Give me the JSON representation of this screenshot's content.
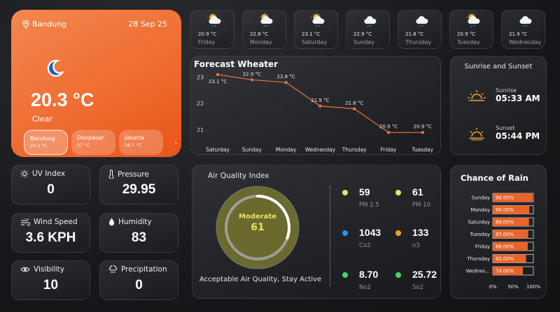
{
  "main": {
    "location": "Bandung",
    "date": "28 Sep 25",
    "temperature": "20.3 °C",
    "condition": "Clear",
    "icon": "moon-icon",
    "next_icon": "chevron-right-icon",
    "cities": [
      {
        "name": "Bandung",
        "temp": "20.3 °C"
      },
      {
        "name": "Denpasar",
        "temp": "27 °C"
      },
      {
        "name": "Jakarta",
        "temp": "26.1 °C"
      }
    ]
  },
  "forecast": [
    {
      "day": "Friday",
      "temp": "20.9 °C",
      "icon": "sun-cloud-rain-icon"
    },
    {
      "day": "Monday",
      "temp": "22.8 °C",
      "icon": "sun-cloud-rain-icon"
    },
    {
      "day": "Saturday",
      "temp": "23.1 °C",
      "icon": "sun-cloud-rain-icon"
    },
    {
      "day": "Sunday",
      "temp": "22.9 °C",
      "icon": "cloud-rain-icon"
    },
    {
      "day": "Thursday",
      "temp": "21.8 °C",
      "icon": "cloud-rain-icon"
    },
    {
      "day": "Tuesday",
      "temp": "20.9 °C",
      "icon": "sun-cloud-rain-icon"
    },
    {
      "day": "Wednesday",
      "temp": "21.9 °C",
      "icon": "cloud-rain-icon"
    }
  ],
  "forecast_chart_title": "Forecast Wheater",
  "sun": {
    "title": "Sunrise and Sunset",
    "sunrise_label": "Sunrise",
    "sunrise_time": "05:33 AM",
    "sunset_label": "Sunset",
    "sunset_time": "05:44 PM"
  },
  "metrics": {
    "uv": {
      "label": "UV Index",
      "value": "0",
      "icon": "sun-rays-icon"
    },
    "pressure": {
      "label": "Pressure",
      "value": "29.95",
      "icon": "thermometer-icon"
    },
    "wind": {
      "label": "Wind Speed",
      "value": "3.6 KPH",
      "icon": "wind-icon"
    },
    "humidity": {
      "label": "Humidity",
      "value": "83",
      "icon": "droplet-icon"
    },
    "visibility": {
      "label": "Visibility",
      "value": "10",
      "icon": "eye-icon"
    },
    "precipitation": {
      "label": "Precipitation",
      "value": "0",
      "icon": "rain-cloud-icon"
    }
  },
  "air": {
    "title": "Air Quality Index",
    "status": "Moderate",
    "value": "61",
    "aqi_fraction": 0.305,
    "message": "Acceptable Air Quality, Stay Active",
    "pollutants": [
      {
        "value": "59",
        "name": "PM 2.5",
        "color": "#e6e36a"
      },
      {
        "value": "61",
        "name": "PM 10",
        "color": "#e6e36a"
      },
      {
        "value": "1043",
        "name": "Co2",
        "color": "#2f8ff0"
      },
      {
        "value": "133",
        "name": "o3",
        "color": "#f0a21c"
      },
      {
        "value": "8.70",
        "name": "No2",
        "color": "#3ed66a"
      },
      {
        "value": "25.72",
        "name": "So2",
        "color": "#3ed66a"
      }
    ]
  },
  "rain_title": "Chance of Rain",
  "colors": {
    "accent_orange": "#e8642a",
    "line_orange": "#e8733a",
    "aqi_yellow": "#e9e25a"
  },
  "chart_data": [
    {
      "type": "line",
      "title": "Forecast Wheater",
      "categories": [
        "Saturday",
        "Sunday",
        "Monday",
        "Wednesday",
        "Thursday",
        "Friday",
        "Tuesday"
      ],
      "values": [
        23.1,
        22.9,
        22.8,
        21.9,
        21.8,
        20.9,
        20.9
      ],
      "data_labels": [
        "23.1 °C",
        "22.9 °C",
        "22.8 °C",
        "21.9 °C",
        "21.8 °C",
        "20.9 °C",
        "20.9 °C"
      ],
      "y_ticks": [
        "23",
        "22",
        "21"
      ],
      "ylim": [
        20.6,
        23.2
      ],
      "grid": false
    },
    {
      "type": "bar",
      "orientation": "horizontal",
      "title": "Chance of Rain",
      "categories": [
        "Sunday",
        "Monday",
        "Saturday",
        "Tuesday",
        "Friday",
        "Thursday",
        "Wednes..."
      ],
      "values": [
        98,
        90,
        89,
        87,
        86,
        82,
        74
      ],
      "data_labels": [
        "98.00%",
        "90.00%",
        "89.00%",
        "87.00%",
        "86.00%",
        "82.00%",
        "74.00%"
      ],
      "x_ticks": [
        "0%",
        "50%",
        "100%"
      ],
      "xlim": [
        0,
        100
      ]
    }
  ]
}
